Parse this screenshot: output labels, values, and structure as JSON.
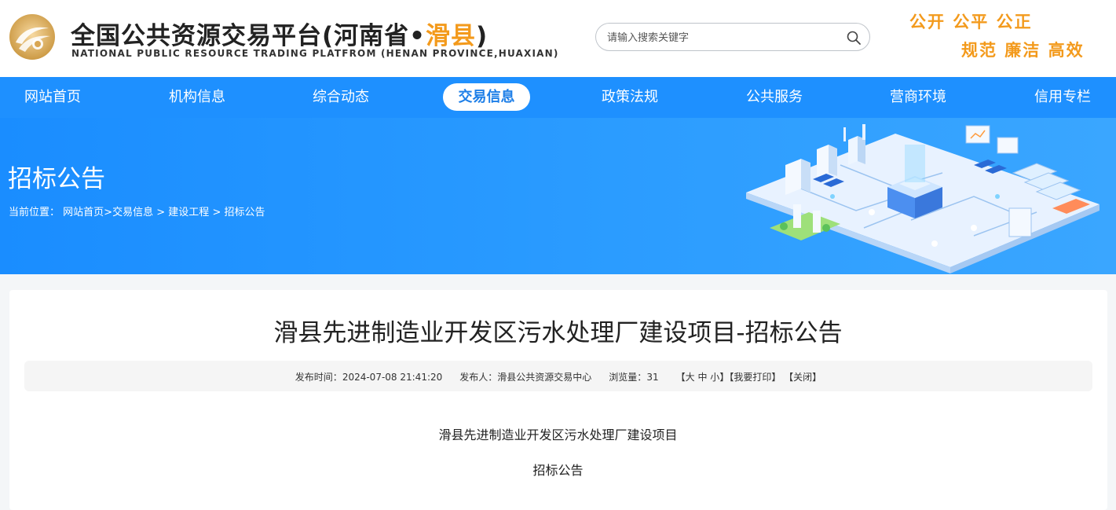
{
  "header": {
    "title_main": "全国公共资源交易平台(河南省•",
    "title_highlight": "滑县",
    "title_end": ")",
    "subtitle": "NATIONAL PUBLIC RESOURCE TRADING PLATFROM (HENAN PROVINCE,HUAXIAN)",
    "slogan_line1": "公开 公平 公正",
    "slogan_line2": "规范 廉洁 高效"
  },
  "search": {
    "placeholder": "请输入搜索关键字",
    "icon": "search-icon"
  },
  "nav": {
    "items": [
      {
        "label": "网站首页"
      },
      {
        "label": "机构信息"
      },
      {
        "label": "综合动态"
      },
      {
        "label": "交易信息",
        "active": true
      },
      {
        "label": "政策法规"
      },
      {
        "label": "公共服务"
      },
      {
        "label": "营商环境"
      },
      {
        "label": "信用专栏"
      }
    ]
  },
  "banner": {
    "title": "招标公告",
    "breadcrumb": {
      "prefix": "当前位置：",
      "items": [
        "网站首页",
        "交易信息",
        "建设工程",
        "招标公告"
      ]
    }
  },
  "article": {
    "title": "滑县先进制造业开发区污水处理厂建设项目-招标公告",
    "meta": {
      "publish_label": "发布时间：",
      "publish_time": "2024-07-08 21:41:20",
      "publisher_label": "发布人：",
      "publisher": "滑县公共资源交易中心",
      "views_label": "浏览量：",
      "views": "31",
      "font_size_open": "【",
      "font_large": "大",
      "font_medium": "中",
      "font_small": "小",
      "font_size_close": "】",
      "print": "【我要打印】",
      "close": "【关闭】"
    },
    "body": {
      "line1": "滑县先进制造业开发区污水处理厂建设项目",
      "line2": "招标公告"
    }
  },
  "colors": {
    "brand_blue": "#1e90ff",
    "accent_orange": "#f39a1c"
  }
}
